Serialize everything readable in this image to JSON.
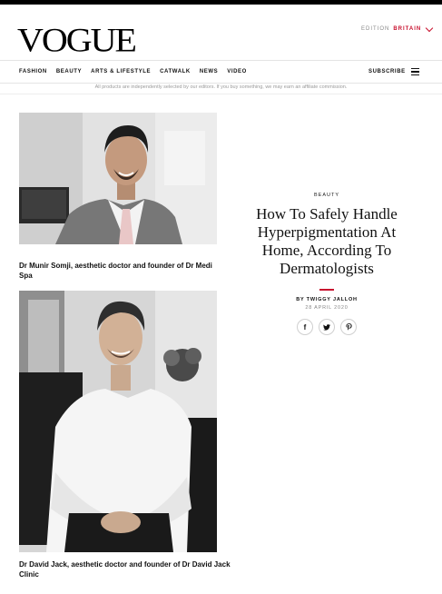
{
  "header": {
    "logo": "VOGUE",
    "edition_label": "EDITION",
    "edition_value": "BRITAIN"
  },
  "nav": {
    "items": [
      "FASHION",
      "BEAUTY",
      "ARTS & LIFESTYLE",
      "CATWALK",
      "NEWS",
      "VIDEO"
    ],
    "subscribe": "SUBSCRIBE",
    "menu_icon": "hamburger-menu-icon"
  },
  "disclaimer": "All products are independently selected by our editors. If you buy something, we may earn an affiliate commission.",
  "article": {
    "category": "BEAUTY",
    "headline": "How To Safely Handle Hyperpigmentation At Home, According To Dermatologists",
    "byline": "BY TWIGGY JALLOH",
    "date": "28 APRIL 2020",
    "share_icons": [
      "facebook-icon",
      "twitter-icon",
      "pinterest-icon"
    ]
  },
  "photos": [
    {
      "caption": "Dr Munir Somji, aesthetic doctor and founder of Dr Medi Spa"
    },
    {
      "caption": "Dr David Jack, aesthetic doctor and founder of Dr David Jack Clinic"
    }
  ],
  "colors": {
    "accent": "#c8102e",
    "text": "#111111",
    "muted": "#888888"
  }
}
